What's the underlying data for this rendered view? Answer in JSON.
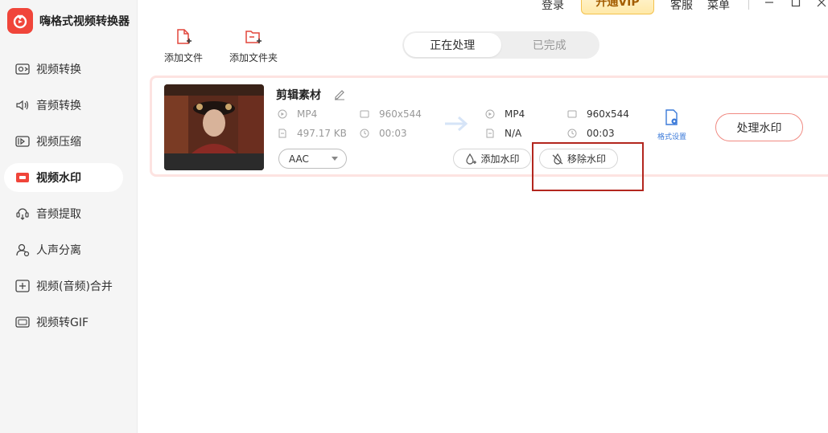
{
  "app": {
    "title": "嗨格式视频转换器"
  },
  "titlebar": {
    "login": "登录",
    "vip": "开通VIP",
    "service": "客服",
    "menu": "菜单"
  },
  "sidebar": {
    "items": [
      {
        "label": "视频转换",
        "icon": "video-convert-icon"
      },
      {
        "label": "音频转换",
        "icon": "audio-convert-icon"
      },
      {
        "label": "视频压缩",
        "icon": "video-compress-icon"
      },
      {
        "label": "视频水印",
        "icon": "video-watermark-icon",
        "active": true
      },
      {
        "label": "音频提取",
        "icon": "audio-extract-icon"
      },
      {
        "label": "人声分离",
        "icon": "voice-separation-icon"
      },
      {
        "label": "视频(音频)合并",
        "icon": "merge-icon"
      },
      {
        "label": "视频转GIF",
        "icon": "gif-icon"
      }
    ]
  },
  "toolbar": {
    "add_file": "添加文件",
    "add_folder": "添加文件夹"
  },
  "tabs": {
    "processing": "正在处理",
    "completed": "已完成"
  },
  "task": {
    "name": "剪辑素材",
    "source": {
      "format": "MP4",
      "resolution": "960x544",
      "size": "497.17 KB",
      "duration": "00:03"
    },
    "output": {
      "format": "MP4",
      "resolution": "960x544",
      "size": "N/A",
      "duration": "00:03"
    },
    "audio_codec": "AAC",
    "add_watermark": "添加水印",
    "remove_watermark": "移除水印",
    "format_settings": "格式设置",
    "process_button": "处理水印"
  },
  "colors": {
    "brand": "#f0453a",
    "vip_border": "#f3c14d",
    "card_border": "#fde3e1",
    "link_blue": "#3b7ad9",
    "highlight": "#b3261e"
  }
}
